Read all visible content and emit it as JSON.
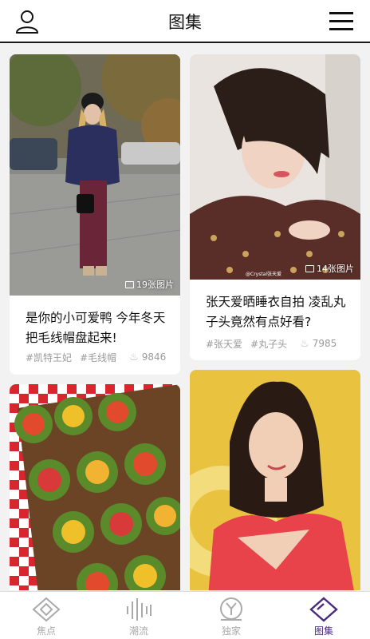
{
  "header": {
    "title": "图集"
  },
  "cards": [
    {
      "title": "是你的小可爱鸭 今年冬天把毛线帽盘起来!",
      "image_count": "19张图片",
      "tags": [
        "#凯特王妃",
        "#毛线帽"
      ],
      "hot": "9846"
    },
    {
      "title": "张天爱晒睡衣自拍 凌乱丸子头竟然有点好看?",
      "image_count": "14张图片",
      "tags": [
        "#张天爱",
        "#丸子头"
      ],
      "hot": "7985",
      "watermark": "@Crystal张天爱"
    },
    {
      "title": "",
      "image_count": "",
      "tags": [],
      "hot": ""
    },
    {
      "title": "",
      "image_count": "",
      "tags": [],
      "hot": ""
    }
  ],
  "tabs": [
    {
      "label": "焦点",
      "icon": "focus-diamond-icon"
    },
    {
      "label": "潮流",
      "icon": "trend-bars-icon"
    },
    {
      "label": "独家",
      "icon": "exclusive-y-icon"
    },
    {
      "label": "图集",
      "icon": "gallery-diamond-icon",
      "active": true
    }
  ],
  "colors": {
    "accent": "#4a2a7a",
    "inactive": "#aaaaaa",
    "header_border": "#1a1a1a"
  }
}
